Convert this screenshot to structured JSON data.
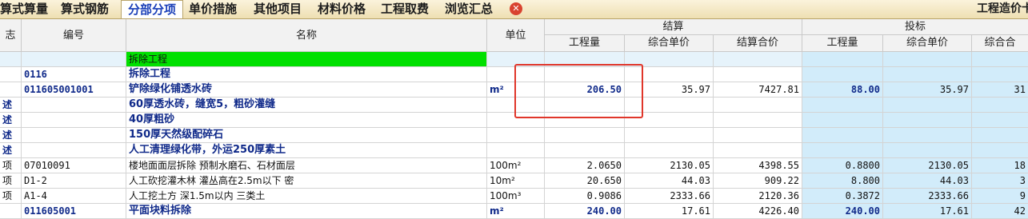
{
  "tabs": [
    {
      "label": "算式算量",
      "active": false
    },
    {
      "label": "算式钢筋",
      "active": false
    },
    {
      "label": "分部分项",
      "active": true
    },
    {
      "label": "单价措施",
      "active": false
    },
    {
      "label": "其他项目",
      "active": false
    },
    {
      "label": "材料价格",
      "active": false
    },
    {
      "label": "工程取费",
      "active": false
    },
    {
      "label": "浏览汇总",
      "active": false
    }
  ],
  "close_icon": "close-icon",
  "close_glyph": "✕",
  "right_label": "工程造价卡",
  "headers": {
    "flag": "志",
    "code": "编号",
    "name": "名称",
    "unit": "单位",
    "settle_group": "结算",
    "bid_group": "投标",
    "qty": "工程量",
    "unit_price": "综合单价",
    "settle_total": "结算合价",
    "bid_total": "综合合"
  },
  "rows": [
    {
      "flag": "",
      "code": "",
      "name": "拆除工程",
      "unit": "",
      "qty": "",
      "price": "",
      "total": "",
      "bqty": "",
      "bprice": "",
      "btotal": ""
    },
    {
      "flag": "",
      "code": "0116",
      "name": "拆除工程",
      "unit": "",
      "qty": "",
      "price": "",
      "total": "",
      "bqty": "",
      "bprice": "",
      "btotal": ""
    },
    {
      "flag": "",
      "code": "011605001001",
      "name": "铲除绿化铺透水砖",
      "unit": "m²",
      "qty": "206.50",
      "price": "35.97",
      "total": "7427.81",
      "bqty": "88.00",
      "bprice": "35.97",
      "btotal": "31"
    },
    {
      "flag": "述",
      "code": "",
      "name": "60厚透水砖，缝宽5，粗砂灌缝",
      "unit": "",
      "qty": "",
      "price": "",
      "total": "",
      "bqty": "",
      "bprice": "",
      "btotal": ""
    },
    {
      "flag": "述",
      "code": "",
      "name": "40厚粗砂",
      "unit": "",
      "qty": "",
      "price": "",
      "total": "",
      "bqty": "",
      "bprice": "",
      "btotal": ""
    },
    {
      "flag": "述",
      "code": "",
      "name": "150厚天然级配碎石",
      "unit": "",
      "qty": "",
      "price": "",
      "total": "",
      "bqty": "",
      "bprice": "",
      "btotal": ""
    },
    {
      "flag": "述",
      "code": "",
      "name": "人工清理绿化带，外运250厚素土",
      "unit": "",
      "qty": "",
      "price": "",
      "total": "",
      "bqty": "",
      "bprice": "",
      "btotal": ""
    },
    {
      "flag": "项",
      "code": "07010091",
      "name": "楼地面面层拆除 预制水磨石、石材面层",
      "unit": "100m²",
      "qty": "2.0650",
      "price": "2130.05",
      "total": "4398.55",
      "bqty": "0.8800",
      "bprice": "2130.05",
      "btotal": "18"
    },
    {
      "flag": "项",
      "code": "D1-2",
      "name": "人工砍挖灌木林 灌丛高在2.5m以下 密",
      "unit": "10m²",
      "qty": "20.650",
      "price": "44.03",
      "total": "909.22",
      "bqty": "8.800",
      "bprice": "44.03",
      "btotal": "3"
    },
    {
      "flag": "项",
      "code": "A1-4",
      "name": "人工挖土方 深1.5m以内 三类土",
      "unit": "100m³",
      "qty": "0.9086",
      "price": "2333.66",
      "total": "2120.36",
      "bqty": "0.3872",
      "bprice": "2333.66",
      "btotal": "9"
    },
    {
      "flag": "",
      "code": "011605001",
      "name": "平面块料拆除",
      "unit": "m²",
      "qty": "240.00",
      "price": "17.61",
      "total": "4226.40",
      "bqty": "240.00",
      "bprice": "17.61",
      "btotal": "42"
    }
  ]
}
